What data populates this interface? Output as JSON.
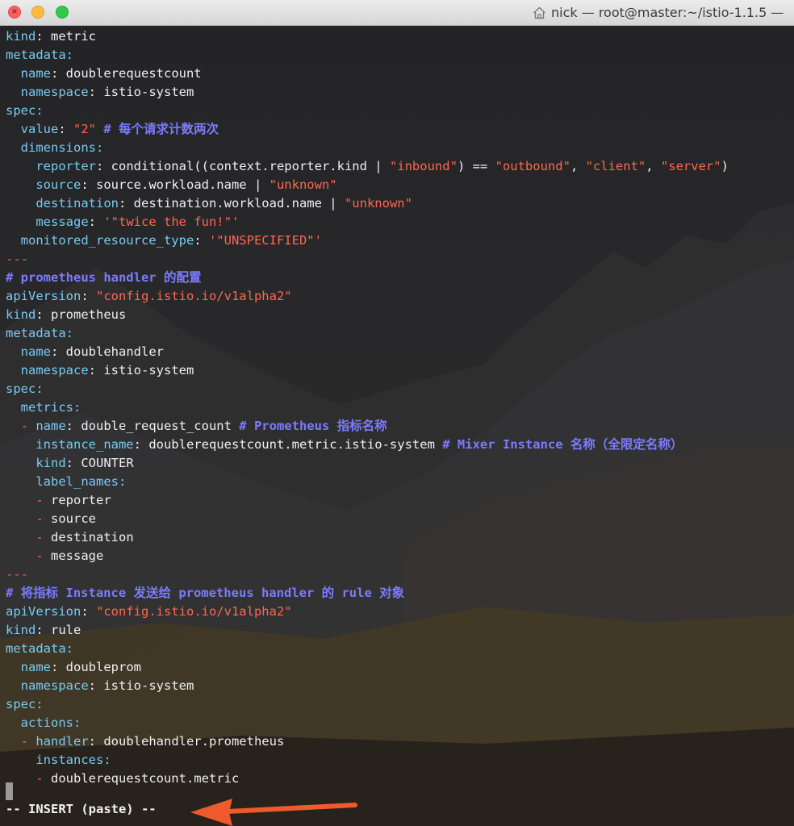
{
  "window": {
    "title": "nick — root@master:~/istio-1.1.5 —",
    "title_icon": "home-icon"
  },
  "lines": [
    [
      {
        "t": "kind",
        "c": "key"
      },
      {
        "t": ": ",
        "c": "txt"
      },
      {
        "t": "metric",
        "c": "txt"
      }
    ],
    [
      {
        "t": "metadata",
        "c": "key"
      },
      {
        "t": ":",
        "c": "key"
      }
    ],
    [
      {
        "t": "  name",
        "c": "key"
      },
      {
        "t": ": ",
        "c": "txt"
      },
      {
        "t": "doublerequestcount",
        "c": "txt"
      }
    ],
    [
      {
        "t": "  namespace",
        "c": "key"
      },
      {
        "t": ": ",
        "c": "txt"
      },
      {
        "t": "istio-system",
        "c": "txt"
      }
    ],
    [
      {
        "t": "spec",
        "c": "key"
      },
      {
        "t": ":",
        "c": "key"
      }
    ],
    [
      {
        "t": "  value",
        "c": "key"
      },
      {
        "t": ": ",
        "c": "txt"
      },
      {
        "t": "\"2\"",
        "c": "str"
      },
      {
        "t": " # 每个请求计数两次",
        "c": "com"
      }
    ],
    [
      {
        "t": "  dimensions",
        "c": "key"
      },
      {
        "t": ":",
        "c": "key"
      }
    ],
    [
      {
        "t": "    reporter",
        "c": "key"
      },
      {
        "t": ": ",
        "c": "txt"
      },
      {
        "t": "conditional((context.reporter.kind | ",
        "c": "txt"
      },
      {
        "t": "\"inbound\"",
        "c": "str"
      },
      {
        "t": ") == ",
        "c": "txt"
      },
      {
        "t": "\"outbound\"",
        "c": "str"
      },
      {
        "t": ", ",
        "c": "txt"
      },
      {
        "t": "\"client\"",
        "c": "str"
      },
      {
        "t": ", ",
        "c": "txt"
      },
      {
        "t": "\"server\"",
        "c": "str"
      },
      {
        "t": ")",
        "c": "txt"
      }
    ],
    [
      {
        "t": "    source",
        "c": "key"
      },
      {
        "t": ": ",
        "c": "txt"
      },
      {
        "t": "source.workload.name | ",
        "c": "txt"
      },
      {
        "t": "\"unknown\"",
        "c": "str"
      }
    ],
    [
      {
        "t": "    destination",
        "c": "key"
      },
      {
        "t": ": ",
        "c": "txt"
      },
      {
        "t": "destination.workload.name | ",
        "c": "txt"
      },
      {
        "t": "\"unknown\"",
        "c": "str"
      }
    ],
    [
      {
        "t": "    message",
        "c": "key"
      },
      {
        "t": ": ",
        "c": "txt"
      },
      {
        "t": "'\"twice the fun!\"'",
        "c": "str"
      }
    ],
    [
      {
        "t": "  monitored_resource_type",
        "c": "key"
      },
      {
        "t": ": ",
        "c": "txt"
      },
      {
        "t": "'\"UNSPECIFIED\"'",
        "c": "str"
      }
    ],
    [
      {
        "t": "---",
        "c": "sep"
      }
    ],
    [
      {
        "t": "# prometheus handler 的配置",
        "c": "com"
      }
    ],
    [
      {
        "t": "apiVersion",
        "c": "key"
      },
      {
        "t": ": ",
        "c": "txt"
      },
      {
        "t": "\"config.istio.io/v1alpha2\"",
        "c": "str"
      }
    ],
    [
      {
        "t": "kind",
        "c": "key"
      },
      {
        "t": ": ",
        "c": "txt"
      },
      {
        "t": "prometheus",
        "c": "txt"
      }
    ],
    [
      {
        "t": "metadata",
        "c": "key"
      },
      {
        "t": ":",
        "c": "key"
      }
    ],
    [
      {
        "t": "  name",
        "c": "key"
      },
      {
        "t": ": ",
        "c": "txt"
      },
      {
        "t": "doublehandler",
        "c": "txt"
      }
    ],
    [
      {
        "t": "  namespace",
        "c": "key"
      },
      {
        "t": ": ",
        "c": "txt"
      },
      {
        "t": "istio-system",
        "c": "txt"
      }
    ],
    [
      {
        "t": "spec",
        "c": "key"
      },
      {
        "t": ":",
        "c": "key"
      }
    ],
    [
      {
        "t": "  metrics",
        "c": "key"
      },
      {
        "t": ":",
        "c": "key"
      }
    ],
    [
      {
        "t": "  - ",
        "c": "dash"
      },
      {
        "t": "name",
        "c": "key"
      },
      {
        "t": ": ",
        "c": "txt"
      },
      {
        "t": "double_request_count",
        "c": "txt"
      },
      {
        "t": " # Prometheus 指标名称",
        "c": "com"
      }
    ],
    [
      {
        "t": "    instance_name",
        "c": "key"
      },
      {
        "t": ": ",
        "c": "txt"
      },
      {
        "t": "doublerequestcount.metric.istio-system",
        "c": "txt"
      },
      {
        "t": " # Mixer Instance 名称（全限定名称）",
        "c": "com"
      }
    ],
    [
      {
        "t": "    kind",
        "c": "key"
      },
      {
        "t": ": ",
        "c": "txt"
      },
      {
        "t": "COUNTER",
        "c": "txt"
      }
    ],
    [
      {
        "t": "    label_names",
        "c": "key"
      },
      {
        "t": ":",
        "c": "key"
      }
    ],
    [
      {
        "t": "    - ",
        "c": "dash"
      },
      {
        "t": "reporter",
        "c": "txt"
      }
    ],
    [
      {
        "t": "    - ",
        "c": "dash"
      },
      {
        "t": "source",
        "c": "txt"
      }
    ],
    [
      {
        "t": "    - ",
        "c": "dash"
      },
      {
        "t": "destination",
        "c": "txt"
      }
    ],
    [
      {
        "t": "    - ",
        "c": "dash"
      },
      {
        "t": "message",
        "c": "txt"
      }
    ],
    [
      {
        "t": "---",
        "c": "sep"
      }
    ],
    [
      {
        "t": "# 将指标 Instance 发送给 prometheus handler 的 rule 对象",
        "c": "com"
      }
    ],
    [
      {
        "t": "apiVersion",
        "c": "key"
      },
      {
        "t": ": ",
        "c": "txt"
      },
      {
        "t": "\"config.istio.io/v1alpha2\"",
        "c": "str"
      }
    ],
    [
      {
        "t": "kind",
        "c": "key"
      },
      {
        "t": ": ",
        "c": "txt"
      },
      {
        "t": "rule",
        "c": "txt"
      }
    ],
    [
      {
        "t": "metadata",
        "c": "key"
      },
      {
        "t": ":",
        "c": "key"
      }
    ],
    [
      {
        "t": "  name",
        "c": "key"
      },
      {
        "t": ": ",
        "c": "txt"
      },
      {
        "t": "doubleprom",
        "c": "txt"
      }
    ],
    [
      {
        "t": "  namespace",
        "c": "key"
      },
      {
        "t": ": ",
        "c": "txt"
      },
      {
        "t": "istio-system",
        "c": "txt"
      }
    ],
    [
      {
        "t": "spec",
        "c": "key"
      },
      {
        "t": ":",
        "c": "key"
      }
    ],
    [
      {
        "t": "  actions",
        "c": "key"
      },
      {
        "t": ":",
        "c": "key"
      }
    ],
    [
      {
        "t": "  - ",
        "c": "dash"
      },
      {
        "t": "handler",
        "c": "key"
      },
      {
        "t": ": ",
        "c": "txt"
      },
      {
        "t": "doublehandler.prometheus",
        "c": "txt"
      }
    ],
    [
      {
        "t": "    instances",
        "c": "key"
      },
      {
        "t": ":",
        "c": "key"
      }
    ],
    [
      {
        "t": "    - ",
        "c": "dash"
      },
      {
        "t": "doublerequestcount.metric",
        "c": "txt"
      }
    ]
  ],
  "status": {
    "mode_text": "-- INSERT (paste) --"
  },
  "annotation": {
    "arrow_color": "#ef5a2c",
    "points_to": "status-mode-text"
  },
  "colors": {
    "key": "#77cbf2",
    "string": "#ff6650",
    "comment": "#7b7bff",
    "text": "#f0f0f0"
  }
}
